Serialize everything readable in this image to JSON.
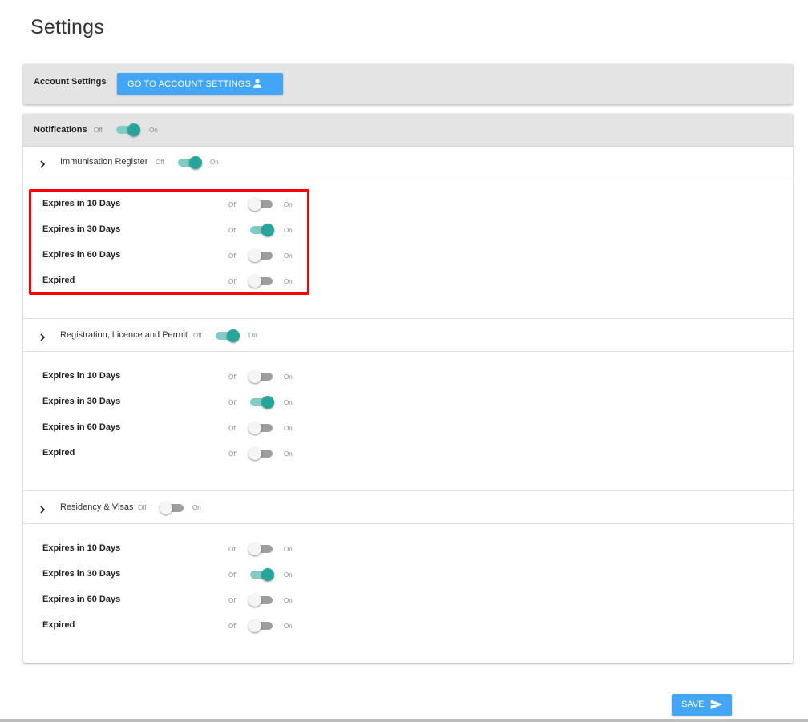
{
  "page": {
    "title": "Settings"
  },
  "account": {
    "label": "Account Settings",
    "button_label": "GO TO ACCOUNT SETTINGS"
  },
  "notifications": {
    "label": "Notifications",
    "off_label": "Off",
    "on_label": "On",
    "enabled": true,
    "sections": [
      {
        "title": "Immunisation Register",
        "enabled": true,
        "items": [
          {
            "label": "Expires in 10 Days",
            "enabled": false
          },
          {
            "label": "Expires in 30 Days",
            "enabled": true
          },
          {
            "label": "Expires in 60 Days",
            "enabled": false
          },
          {
            "label": "Expired",
            "enabled": false
          }
        ]
      },
      {
        "title": "Registration, Licence and Permit",
        "enabled": true,
        "items": [
          {
            "label": "Expires in 10 Days",
            "enabled": false
          },
          {
            "label": "Expires in 30 Days",
            "enabled": true
          },
          {
            "label": "Expires in 60 Days",
            "enabled": false
          },
          {
            "label": "Expired",
            "enabled": false
          }
        ]
      },
      {
        "title": "Residency & Visas",
        "enabled": false,
        "items": [
          {
            "label": "Expires in 10 Days",
            "enabled": false
          },
          {
            "label": "Expires in 30 Days",
            "enabled": true
          },
          {
            "label": "Expires in 60 Days",
            "enabled": false
          },
          {
            "label": "Expired",
            "enabled": false
          }
        ]
      }
    ]
  },
  "footer": {
    "save_label": "SAVE"
  },
  "colors": {
    "primary": "#42a5f5",
    "toggle_on": "#26a69a",
    "toggle_on_track": "#80cbc4",
    "highlight": "#ff0000"
  },
  "icons": {
    "account_button": "person-icon",
    "save_button": "send-icon",
    "section_expand": "chevron-right-icon"
  }
}
